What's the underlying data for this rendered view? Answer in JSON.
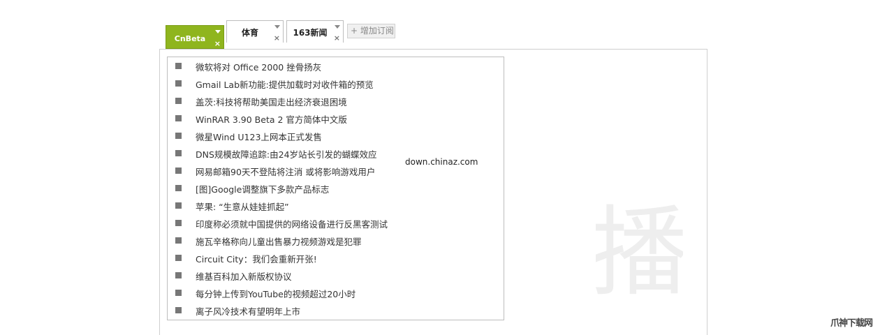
{
  "tabs": [
    {
      "label": "CnBeta",
      "active": true
    },
    {
      "label": "体育",
      "active": false
    },
    {
      "label": "163新闻",
      "active": false
    }
  ],
  "add_button": "+ 增加订阅",
  "close_glyph": "×",
  "news": [
    "微软将对  Office 2000 挫骨扬灰",
    "Gmail Lab新功能:提供加载时对收件箱的预览",
    "盖茨:科技将帮助美国走出经济衰退困境",
    "WinRAR 3.90 Beta 2 官方简体中文版",
    "微星Wind U123上网本正式发售",
    "DNS规模故障追踪:由24岁站长引发的蝴蝶效应",
    "网易邮箱90天不登陆将注消  或将影响游戏用户",
    "[图]Google调整旗下多款产品标志",
    "苹果: “生意从娃娃抓起”",
    "印度称必须就中国提供的网络设备进行反黑客测试",
    "施瓦辛格称向儿童出售暴力视频游戏是犯罪",
    "Circuit City：我们会重新开张!",
    "维基百科加入新版权协议",
    "每分钟上传到YouTube的视频超过20小时",
    "离子风冷技术有望明年上市"
  ],
  "site_label": "down.chinaz.com",
  "watermark_char": "播",
  "corner_logo": "爪神下载网",
  "colors": {
    "active_tab": "#8fb51e",
    "bullet": "#777777",
    "watermark": "#eeeeee"
  }
}
